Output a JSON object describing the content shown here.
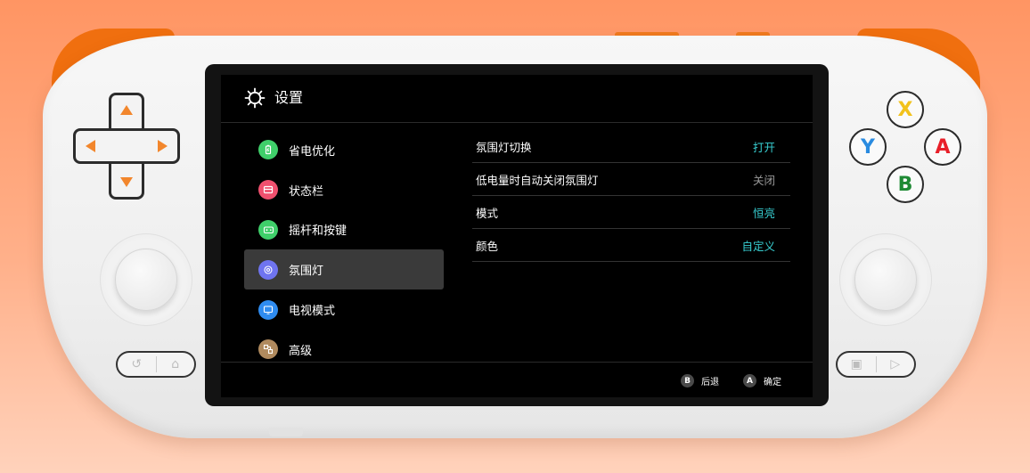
{
  "header": {
    "title": "设置",
    "icon": "gear-icon"
  },
  "sidebar": {
    "items": [
      {
        "label": "省电优化",
        "icon": "battery-icon",
        "color": "#3fcf6a",
        "active": false
      },
      {
        "label": "状态栏",
        "icon": "status-bar-icon",
        "color": "#f0506e",
        "active": false
      },
      {
        "label": "摇杆和按键",
        "icon": "gamepad-icon",
        "color": "#3fcf6a",
        "active": false
      },
      {
        "label": "氛围灯",
        "icon": "ambient-light-icon",
        "color": "#6f74f0",
        "active": true
      },
      {
        "label": "电视模式",
        "icon": "tv-icon",
        "color": "#2f8cf0",
        "active": false
      },
      {
        "label": "高级",
        "icon": "advanced-icon",
        "color": "#b08a5e",
        "active": false
      }
    ]
  },
  "settings": {
    "rows": [
      {
        "label": "氛围灯切换",
        "value": "打开",
        "value_color": "#38d0d3"
      },
      {
        "label": "低电量时自动关闭氛围灯",
        "value": "关闭",
        "value_color": "#9a9a9a"
      },
      {
        "label": "模式",
        "value": "恒亮",
        "value_color": "#38d0d3"
      },
      {
        "label": "颜色",
        "value": "自定义",
        "value_color": "#38d0d3"
      }
    ]
  },
  "footer": {
    "back": {
      "key": "B",
      "label": "后退"
    },
    "confirm": {
      "key": "A",
      "label": "确定"
    }
  },
  "device": {
    "face_buttons": {
      "x": {
        "label": "X",
        "color": "#f2c21b"
      },
      "y": {
        "label": "Y",
        "color": "#2a8be0"
      },
      "a": {
        "label": "A",
        "color": "#e8202a"
      },
      "b": {
        "label": "B",
        "color": "#1e8a34"
      }
    },
    "left_pill": {
      "icons": [
        "back-icon",
        "home-icon"
      ]
    },
    "right_pill": {
      "icons": [
        "menu-icon",
        "start-icon"
      ]
    },
    "accent_color": "#f06f0f"
  }
}
